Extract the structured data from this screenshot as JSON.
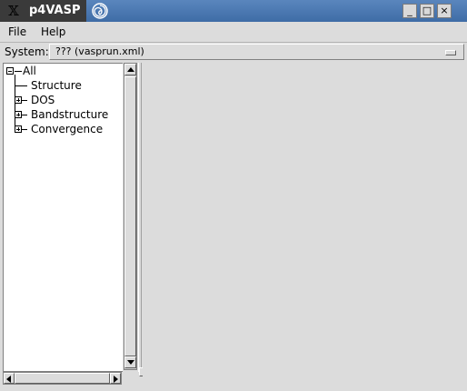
{
  "window": {
    "title": "p4VASP",
    "app_icon": "x-logo-icon",
    "launcher_icon": "swirl-icon",
    "controls": {
      "minimize": "_",
      "maximize": "□",
      "close": "×"
    }
  },
  "menu": {
    "items": [
      "File",
      "Help"
    ]
  },
  "system": {
    "label": "System:",
    "value": "??? (vasprun.xml)"
  },
  "tree": {
    "nodes": [
      {
        "label": "All",
        "expander": "minus"
      },
      {
        "label": "Structure",
        "expander": "none"
      },
      {
        "label": "DOS",
        "expander": "plus"
      },
      {
        "label": "Bandstructure",
        "expander": "plus"
      },
      {
        "label": "Convergence",
        "expander": "plus"
      }
    ]
  },
  "colors": {
    "titlebar": "#4a78b2",
    "panel": "#dcdcdc",
    "tree_bg": "#ffffff"
  }
}
